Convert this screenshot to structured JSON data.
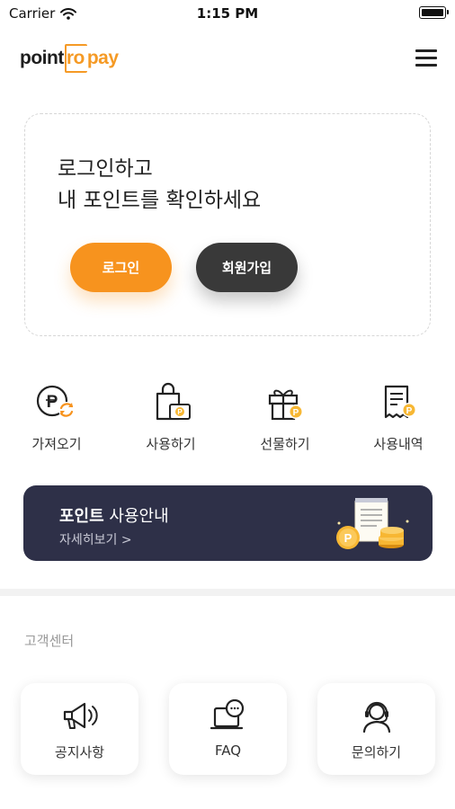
{
  "status_bar": {
    "carrier": "Carrier",
    "time": "1:15 PM"
  },
  "header": {
    "logo": {
      "part1": "point",
      "part2": "ro",
      "part3": "pay"
    },
    "menu_icon": "hamburger-menu-icon"
  },
  "login_card": {
    "message_line1": "로그인하고",
    "message_line2": "내 포인트를 확인하세요",
    "login_button": "로그인",
    "signup_button": "회원가입"
  },
  "quick_menu": [
    {
      "label": "가져오기",
      "icon": "point-import-icon"
    },
    {
      "label": "사용하기",
      "icon": "shopping-bag-icon"
    },
    {
      "label": "선물하기",
      "icon": "gift-icon"
    },
    {
      "label": "사용내역",
      "icon": "receipt-icon"
    }
  ],
  "banner": {
    "title_bold": "포인트",
    "title_rest": " 사용안내",
    "more_link": "자세히보기 >"
  },
  "customer_center": {
    "title": "고객센터",
    "items": [
      {
        "label": "공지사항",
        "icon": "megaphone-icon"
      },
      {
        "label": "FAQ",
        "icon": "faq-icon"
      },
      {
        "label": "문의하기",
        "icon": "headset-agent-icon"
      }
    ]
  },
  "colors": {
    "brand_orange": "#f7931e",
    "dark_button": "#393939",
    "banner_navy": "#2e3048",
    "coin_yellow": "#f7b733"
  }
}
